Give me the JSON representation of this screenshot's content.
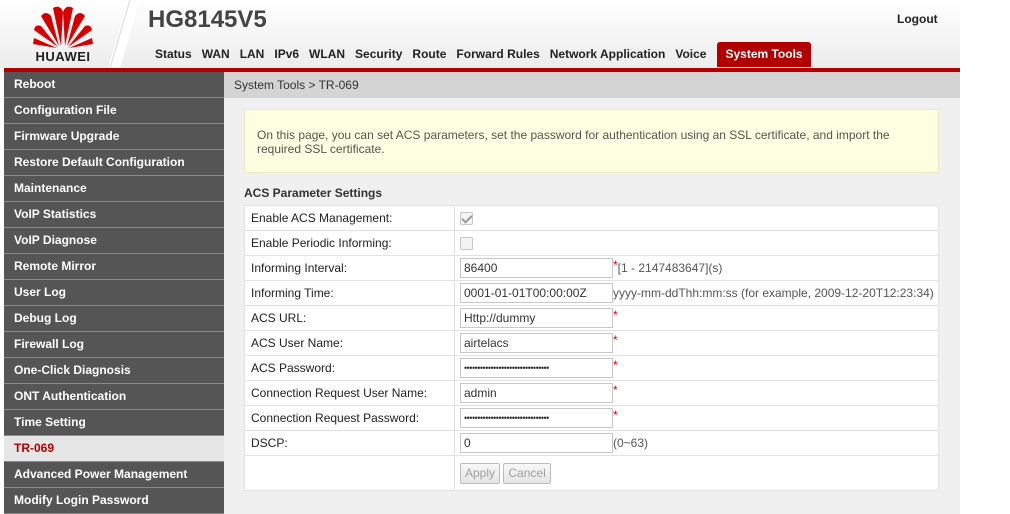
{
  "header": {
    "brand": "HUAWEI",
    "model": "HG8145V5",
    "logout": "Logout",
    "brand_color": "#b20000"
  },
  "nav": {
    "items": [
      "Status",
      "WAN",
      "LAN",
      "IPv6",
      "WLAN",
      "Security",
      "Route",
      "Forward Rules",
      "Network Application",
      "Voice",
      "System Tools"
    ],
    "active": "System Tools"
  },
  "sidebar": {
    "items": [
      "Reboot",
      "Configuration File",
      "Firmware Upgrade",
      "Restore Default Configuration",
      "Maintenance",
      "VoIP Statistics",
      "VoIP Diagnose",
      "Remote Mirror",
      "User Log",
      "Debug Log",
      "Firewall Log",
      "One-Click Diagnosis",
      "ONT Authentication",
      "Time Setting",
      "TR-069",
      "Advanced Power Management",
      "Modify Login Password"
    ],
    "active": "TR-069"
  },
  "breadcrumb": "System Tools > TR-069",
  "notice": "On this page, you can set ACS parameters, set the password for authentication using an SSL certificate, and import the required SSL certificate.",
  "section_title": "ACS Parameter Settings",
  "form": {
    "enable_acs": {
      "label": "Enable ACS Management:",
      "checked": true
    },
    "periodic": {
      "label": "Enable Periodic Informing:",
      "checked": false
    },
    "interval": {
      "label": "Informing Interval:",
      "value": "86400",
      "required": "*",
      "hint": "[1 - 2147483647](s)"
    },
    "time": {
      "label": "Informing Time:",
      "value": "0001-01-01T00:00:00Z",
      "hint": "yyyy-mm-ddThh:mm:ss (for example, 2009-12-20T12:23:34)"
    },
    "acs_url": {
      "label": "ACS URL:",
      "value": "Http://dummy",
      "required": "*"
    },
    "acs_user": {
      "label": "ACS User Name:",
      "value": "airtelacs",
      "required": "*"
    },
    "acs_pass": {
      "label": "ACS Password:",
      "value": "••••••••••••••••••••••••••••••••",
      "required": "*"
    },
    "conn_user": {
      "label": "Connection Request User Name:",
      "value": "admin",
      "required": "*"
    },
    "conn_pass": {
      "label": "Connection Request Password:",
      "value": "••••••••••••••••••••••••••••••••",
      "required": "*"
    },
    "dscp": {
      "label": "DSCP:",
      "value": "0",
      "hint": "(0~63)"
    }
  },
  "buttons": {
    "apply": "Apply",
    "cancel": "Cancel"
  }
}
